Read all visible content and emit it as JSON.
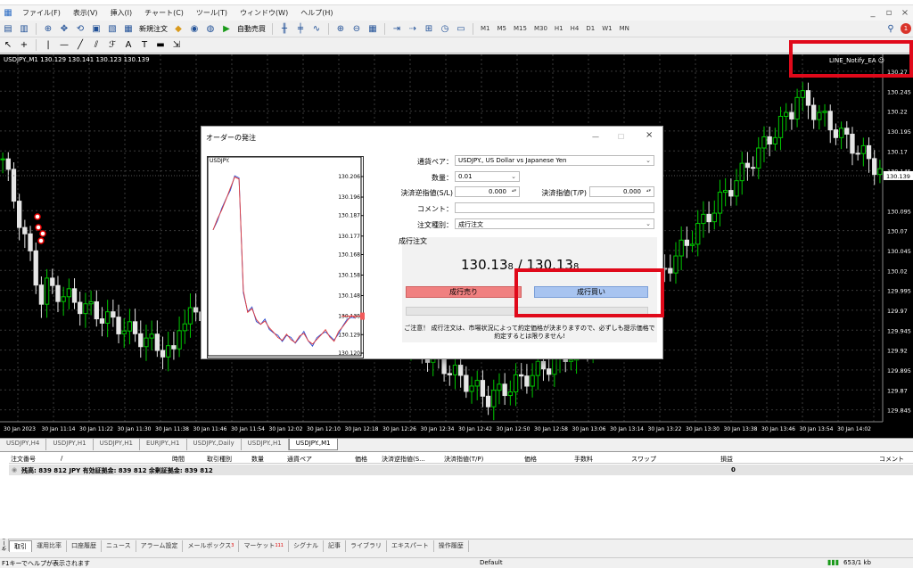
{
  "menu": [
    "ファイル(F)",
    "表示(V)",
    "挿入(I)",
    "チャート(C)",
    "ツール(T)",
    "ウィンドウ(W)",
    "ヘルプ(H)"
  ],
  "toolbar": {
    "new_order": "新規注文",
    "auto_trade": "自動売買",
    "timeframes": [
      "M1",
      "M5",
      "M15",
      "M30",
      "H1",
      "H4",
      "D1",
      "W1",
      "MN"
    ],
    "notification_count": "1"
  },
  "chart": {
    "info": "USDJPY.,M1  130.129 130.141 130.123 130.139",
    "ea_label": "LINE_Notify_EA ☺",
    "current_price": "130.139",
    "price_labels": [
      "130.27",
      "130.245",
      "130.22",
      "130.195",
      "130.17",
      "130.145",
      "130.139",
      "130.095",
      "130.07",
      "130.045",
      "130.02",
      "129.995",
      "129.97",
      "129.945",
      "129.92",
      "129.895",
      "129.87",
      "129.845"
    ],
    "time_labels": [
      "30 Jan 2023",
      "30 Jan 11:14",
      "30 Jan 11:22",
      "30 Jan 11:30",
      "30 Jan 11:38",
      "30 Jan 11:46",
      "30 Jan 11:54",
      "30 Jan 12:02",
      "30 Jan 12:10",
      "30 Jan 12:18",
      "30 Jan 12:26",
      "30 Jan 12:34",
      "30 Jan 12:42",
      "30 Jan 12:50",
      "30 Jan 12:58",
      "30 Jan 13:06",
      "30 Jan 13:14",
      "30 Jan 13:22",
      "30 Jan 13:30",
      "30 Jan 13:38",
      "30 Jan 13:46",
      "30 Jan 13:54",
      "30 Jan 14:02"
    ]
  },
  "chart_tabs": [
    "USDJPY,H4",
    "USDJPY,H1",
    "USDJPY,H1",
    "EURJPY.,H1",
    "USDJPY.,Daily",
    "USDJPY.,H1",
    "USDJPY.,M1"
  ],
  "dialog": {
    "title": "オーダーの発注",
    "mini_symbol": "USDJPY.",
    "mini_prices": [
      "130.206",
      "130.196",
      "130.187",
      "130.177",
      "130.168",
      "130.158",
      "130.148",
      "130.138",
      "130.129",
      "130.120"
    ],
    "symbol_label": "通貨ペア：",
    "symbol_value": "USDJPY., US Dollar vs Japanese Yen",
    "volume_label": "数量：",
    "volume_value": "0.01",
    "sl_label": "決済逆指値(S/L)",
    "sl_value": "0.000",
    "tp_label": "決済指値(T/P)",
    "tp_value": "0.000",
    "comment_label": "コメント：",
    "comment_value": "",
    "type_label": "注文種別：",
    "type_value": "成行注文",
    "section_title": "成行注文",
    "bid_main": "130.13",
    "bid_small": "8",
    "ask_main": "130.13",
    "ask_small": "8",
    "sell_button": "成行売り",
    "buy_button": "成行買い",
    "note": "ご注意！ 成行注文は、市場状況によって約定価格が決まりますので、必ずしも提示価格で約定するとは限りません!"
  },
  "terminal": {
    "headers": [
      "注文番号",
      "/",
      "時間",
      "取引種別",
      "数量",
      "通貨ペア",
      "価格",
      "決済逆指値(S...",
      "決済指値(T/P)",
      "価格",
      "手数料",
      "スワップ",
      "損益",
      "コメント"
    ],
    "balance_row": "残高: 839 812 JPY  有効証拠金: 839 812  余剰証拠金: 839 812",
    "profit": "0",
    "side_label": "ターミナル",
    "tabs": [
      "取引",
      "運用比率",
      "口座履歴",
      "ニュース",
      "アラーム設定",
      "メールボックス",
      "マーケット",
      "シグナル",
      "記事",
      "ライブラリ",
      "エキスパート",
      "操作履歴"
    ],
    "mail_badge": "3",
    "market_badge": "111"
  },
  "status": {
    "help": "F1キーでヘルプが表示されます",
    "profile": "Default",
    "traffic": "653/1 kb"
  },
  "colors": {
    "red_box": "#e0091a",
    "sell": "#f08080",
    "buy": "#a8c4f0",
    "candle_up": "#00c800",
    "candle_down": "#e6e6e6"
  }
}
